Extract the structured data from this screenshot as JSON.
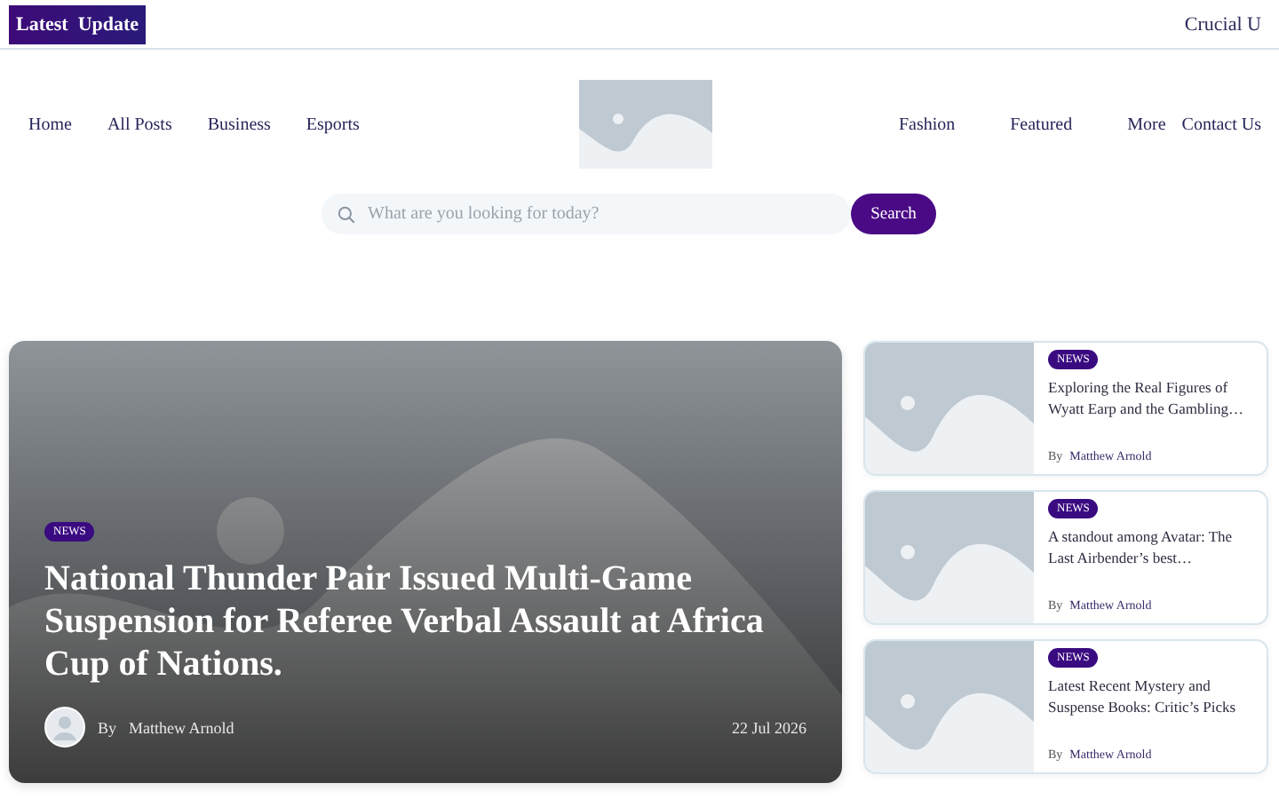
{
  "topbar": {
    "badge": "Latest  Update",
    "ticker": "Crucial U"
  },
  "nav_left": [
    "Home",
    "All Posts",
    "Business",
    "Esports"
  ],
  "nav_right": [
    "Fashion",
    "Featured",
    "More",
    "Contact Us"
  ],
  "search": {
    "placeholder": "What are you looking for today?",
    "button": "Search"
  },
  "hero": {
    "tag": "NEWS",
    "title": "National Thunder Pair Issued Multi-Game Suspension for Referee Verbal Assault at Africa Cup of Nations.",
    "by": "By",
    "author": "Matthew Arnold",
    "date": "22 Jul 2026"
  },
  "side_posts": [
    {
      "tag": "NEWS",
      "title": "Exploring the Real Figures of Wyatt Earp and the Gambling…",
      "by": "By",
      "author": "Matthew Arnold"
    },
    {
      "tag": "NEWS",
      "title": "A standout among Avatar: The Last Airbender’s best…",
      "by": "By",
      "author": "Matthew Arnold"
    },
    {
      "tag": "NEWS",
      "title": "Latest Recent Mystery and Suspense Books: Critic’s Picks",
      "by": "By",
      "author": "Matthew Arnold"
    }
  ]
}
